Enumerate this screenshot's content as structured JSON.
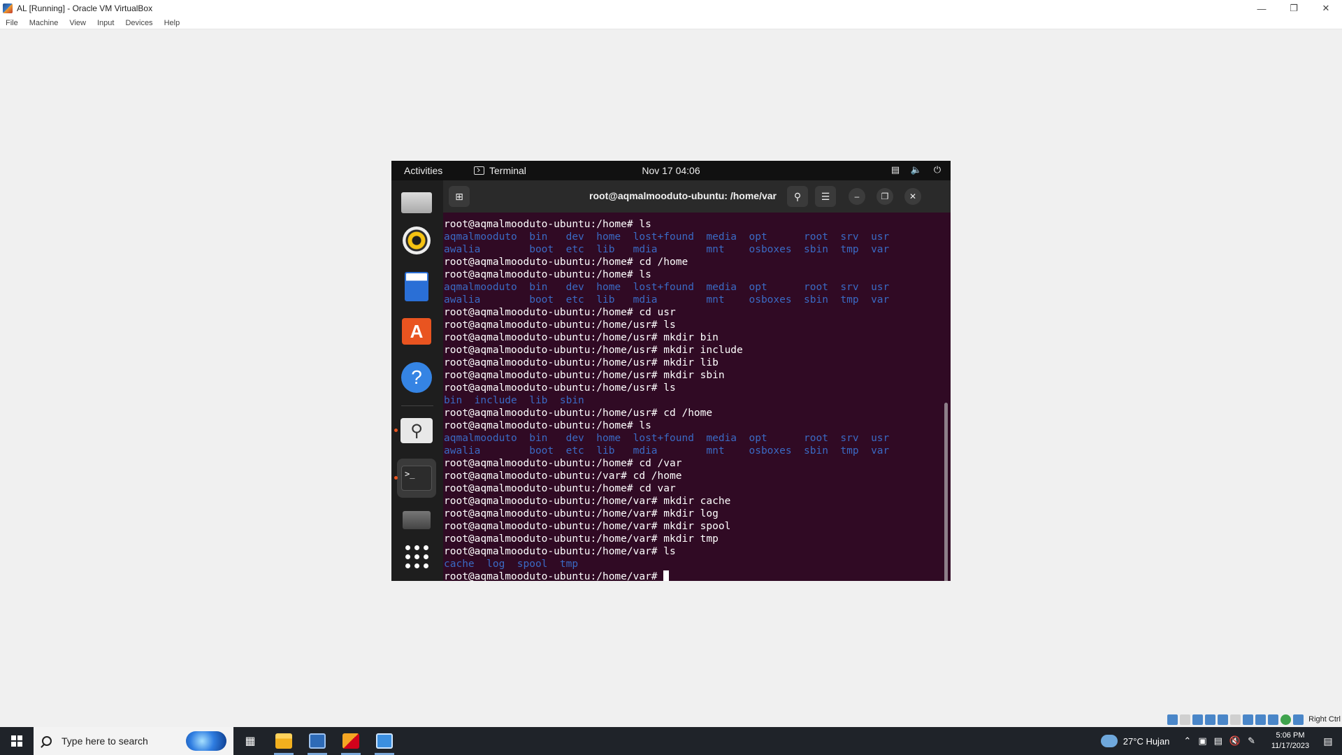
{
  "host": {
    "title": "AL [Running] - Oracle VM VirtualBox",
    "menu": [
      "File",
      "Machine",
      "View",
      "Input",
      "Devices",
      "Help"
    ],
    "status_right": "Right Ctrl"
  },
  "gnome": {
    "activities": "Activities",
    "app_name": "Terminal",
    "clock": "Nov 17  04:06"
  },
  "terminal": {
    "title": "root@aqmalmooduto-ubuntu: /home/var",
    "lines": [
      {
        "type": "cmd",
        "text": "root@aqmalmooduto-ubuntu:/home# ls"
      },
      {
        "type": "dir",
        "text": "aqmalmooduto  bin   dev  home  lost+found  media  opt      root  srv  usr"
      },
      {
        "type": "dir",
        "text": "awalia        boot  etc  lib   mdia        mnt    osboxes  sbin  tmp  var"
      },
      {
        "type": "cmd",
        "text": "root@aqmalmooduto-ubuntu:/home# cd /home"
      },
      {
        "type": "cmd",
        "text": "root@aqmalmooduto-ubuntu:/home# ls"
      },
      {
        "type": "dir",
        "text": "aqmalmooduto  bin   dev  home  lost+found  media  opt      root  srv  usr"
      },
      {
        "type": "dir",
        "text": "awalia        boot  etc  lib   mdia        mnt    osboxes  sbin  tmp  var"
      },
      {
        "type": "cmd",
        "text": "root@aqmalmooduto-ubuntu:/home# cd usr"
      },
      {
        "type": "cmd",
        "text": "root@aqmalmooduto-ubuntu:/home/usr# ls"
      },
      {
        "type": "cmd",
        "text": "root@aqmalmooduto-ubuntu:/home/usr# mkdir bin"
      },
      {
        "type": "cmd",
        "text": "root@aqmalmooduto-ubuntu:/home/usr# mkdir include"
      },
      {
        "type": "cmd",
        "text": "root@aqmalmooduto-ubuntu:/home/usr# mkdir lib"
      },
      {
        "type": "cmd",
        "text": "root@aqmalmooduto-ubuntu:/home/usr# mkdir sbin"
      },
      {
        "type": "cmd",
        "text": "root@aqmalmooduto-ubuntu:/home/usr# ls"
      },
      {
        "type": "dir",
        "text": "bin  include  lib  sbin"
      },
      {
        "type": "cmd",
        "text": "root@aqmalmooduto-ubuntu:/home/usr# cd /home"
      },
      {
        "type": "cmd",
        "text": "root@aqmalmooduto-ubuntu:/home# ls"
      },
      {
        "type": "dir",
        "text": "aqmalmooduto  bin   dev  home  lost+found  media  opt      root  srv  usr"
      },
      {
        "type": "dir",
        "text": "awalia        boot  etc  lib   mdia        mnt    osboxes  sbin  tmp  var"
      },
      {
        "type": "cmd",
        "text": "root@aqmalmooduto-ubuntu:/home# cd /var"
      },
      {
        "type": "cmd",
        "text": "root@aqmalmooduto-ubuntu:/var# cd /home"
      },
      {
        "type": "cmd",
        "text": "root@aqmalmooduto-ubuntu:/home# cd var"
      },
      {
        "type": "cmd",
        "text": "root@aqmalmooduto-ubuntu:/home/var# mkdir cache"
      },
      {
        "type": "cmd",
        "text": "root@aqmalmooduto-ubuntu:/home/var# mkdir log"
      },
      {
        "type": "cmd",
        "text": "root@aqmalmooduto-ubuntu:/home/var# mkdir spool"
      },
      {
        "type": "cmd",
        "text": "root@aqmalmooduto-ubuntu:/home/var# mkdir tmp"
      },
      {
        "type": "cmd",
        "text": "root@aqmalmooduto-ubuntu:/home/var# ls"
      },
      {
        "type": "dir",
        "text": "cache  log  spool  tmp"
      }
    ],
    "prompt": "root@aqmalmooduto-ubuntu:/home/var# "
  },
  "taskbar": {
    "search_placeholder": "Type here to search",
    "weather": "27°C  Hujan",
    "time": "5:06 PM",
    "date": "11/17/2023"
  },
  "colors": {
    "terminal_bg": "#300a24",
    "dir_blue": "#3a6ac4",
    "ubuntu_orange": "#e95420"
  }
}
